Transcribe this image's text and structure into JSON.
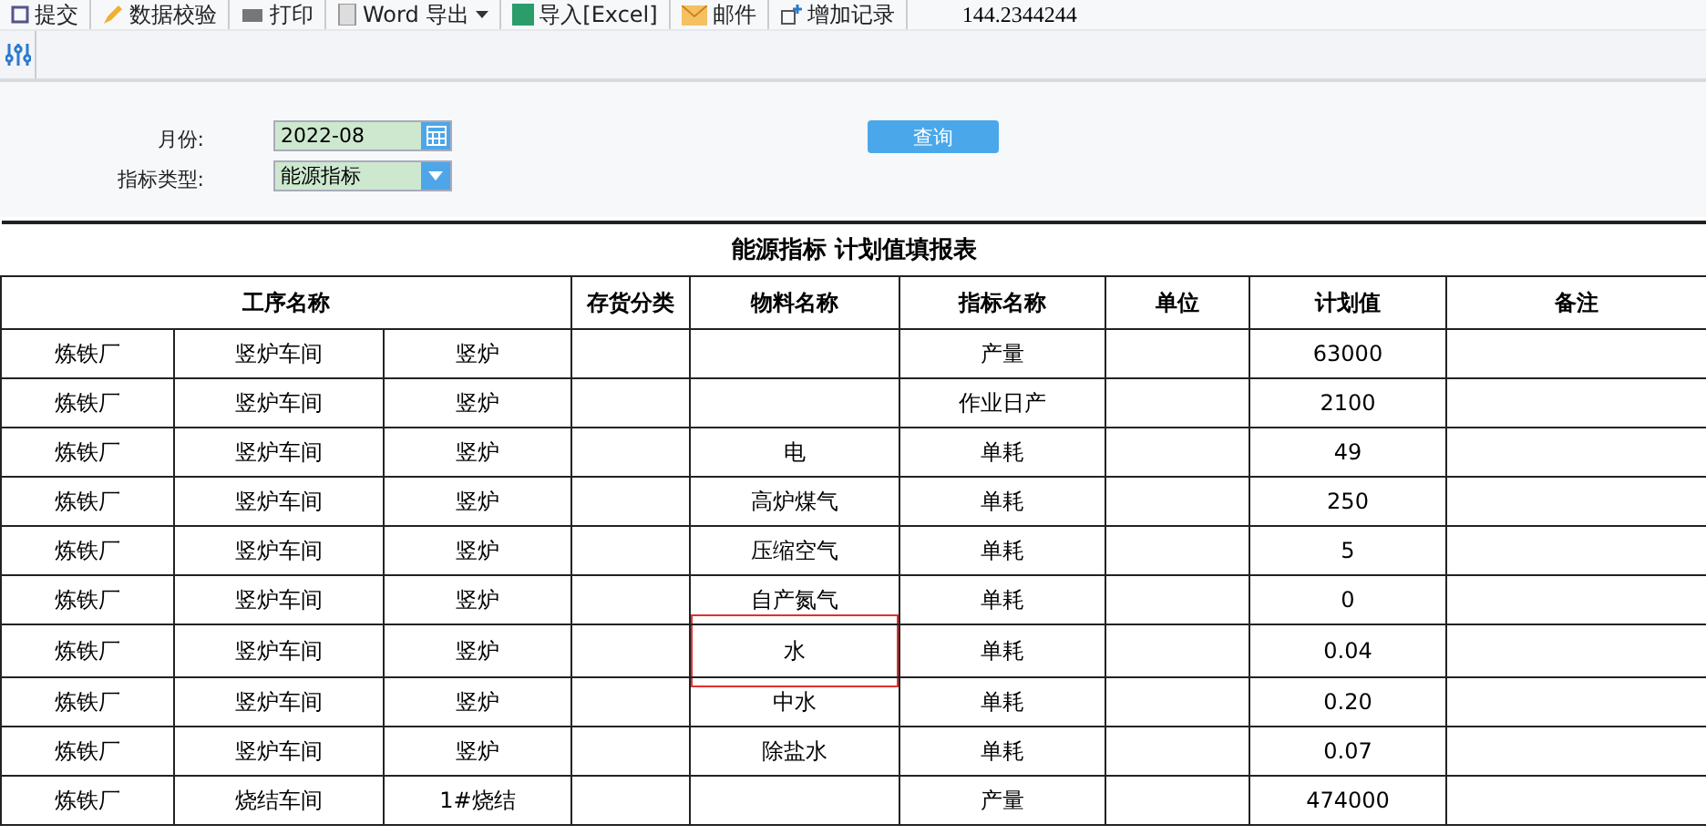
{
  "toolbar": [
    {
      "label": "提交",
      "caret": false
    },
    {
      "label": "数据校验",
      "caret": false
    },
    {
      "label": "打印",
      "caret": false
    },
    {
      "label": "Word 导出",
      "caret": true
    },
    {
      "label": "导入[Excel]",
      "caret": false
    },
    {
      "label": "邮件",
      "caret": false
    },
    {
      "label": "增加记录",
      "caret": false
    }
  ],
  "toolbar_info": "144.2344244",
  "form": {
    "month_label": "月份:",
    "month_value": "2022-08",
    "type_label": "指标类型:",
    "type_value": "能源指标",
    "query_button": "查询"
  },
  "table": {
    "title": "能源指标 计划值填报表",
    "columns": [
      "工序名称",
      "存货分类",
      "物料名称",
      "指标名称",
      "单位",
      "计划值",
      "备注"
    ],
    "rows": [
      {
        "process": [
          "炼铁厂",
          "竖炉车间",
          "竖炉"
        ],
        "indicator": "产量",
        "plan": "63000",
        "selected": false
      },
      {
        "process": [
          "炼铁厂",
          "竖炉车间",
          "竖炉"
        ],
        "indicator": "作业日产",
        "plan": "2100",
        "selected": false
      },
      {
        "process": [
          "炼铁厂",
          "竖炉车间",
          "竖炉"
        ],
        "material": "电",
        "indicator": "单耗",
        "plan": "49",
        "selected": false
      },
      {
        "process": [
          "炼铁厂",
          "竖炉车间",
          "竖炉"
        ],
        "material": "高炉煤气",
        "indicator": "单耗",
        "plan": "250",
        "selected": false
      },
      {
        "process": [
          "炼铁厂",
          "竖炉车间",
          "竖炉"
        ],
        "material": "压缩空气",
        "indicator": "单耗",
        "plan": "5",
        "selected": false
      },
      {
        "process": [
          "炼铁厂",
          "竖炉车间",
          "竖炉"
        ],
        "material": "自产氮气",
        "indicator": "单耗",
        "plan": "0",
        "selected": false
      },
      {
        "process": [
          "炼铁厂",
          "竖炉车间",
          "竖炉"
        ],
        "material": "水",
        "indicator": "单耗",
        "plan": "0.04",
        "selected": true
      },
      {
        "process": [
          "炼铁厂",
          "竖炉车间",
          "竖炉"
        ],
        "material": "中水",
        "indicator": "单耗",
        "plan": "0.20",
        "selected": false
      },
      {
        "process": [
          "炼铁厂",
          "竖炉车间",
          "竖炉"
        ],
        "material": "除盐水",
        "indicator": "单耗",
        "plan": "0.07",
        "selected": false
      },
      {
        "process": [
          "炼铁厂",
          "烧结车间",
          "1#烧结"
        ],
        "indicator": "产量",
        "plan": "474000",
        "selected": false
      }
    ]
  }
}
